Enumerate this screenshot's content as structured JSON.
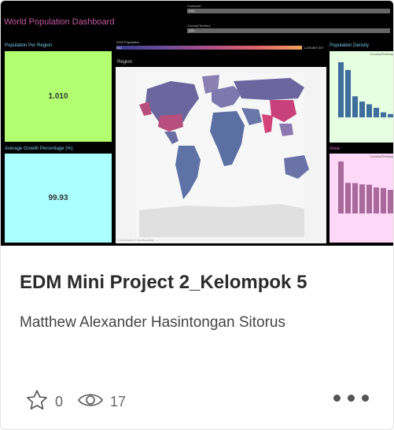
{
  "card": {
    "title": "EDM Mini Project 2_Kelompok 5",
    "author": "Matthew Alexander Hasintongan Sitorus",
    "favorites": "0",
    "views": "17"
  },
  "dashboard": {
    "title": "World Population Dashboard",
    "filters": [
      {
        "label": "Continent",
        "value": "(All)"
      },
      {
        "label": "Country/Territory",
        "value": "(All)"
      }
    ],
    "population_scale": {
      "label": "2022 Population",
      "min": "510",
      "max": "1,425,887,337"
    },
    "panels": {
      "population_per_region": {
        "label": "Population Per Region",
        "value": "1.010"
      },
      "average_growth": {
        "label": "Average Growth Percentage (%)",
        "value": "99.93"
      },
      "region": {
        "label": "Region",
        "footer": "© 2024 Mapbox © OpenStreetMap"
      },
      "density": {
        "label": "Population Density",
        "legend": "Country/Territory"
      },
      "area": {
        "label": "Area",
        "legend": "Country/Territory"
      }
    },
    "colors": {
      "kpi_green": "#b2ff70",
      "kpi_cyan": "#aaffff",
      "density_bar": "#3f6d9e",
      "area_bar": "#a86a9a"
    }
  },
  "chart_data": [
    {
      "type": "bar",
      "title": "Population Density",
      "values": [
        22000,
        18900,
        8400,
        6300,
        5200,
        3800,
        2000,
        1300
      ]
    },
    {
      "type": "bar",
      "title": "Area",
      "values": [
        17000,
        10000,
        9900,
        9500,
        9400,
        8500,
        8300,
        7700
      ]
    }
  ]
}
